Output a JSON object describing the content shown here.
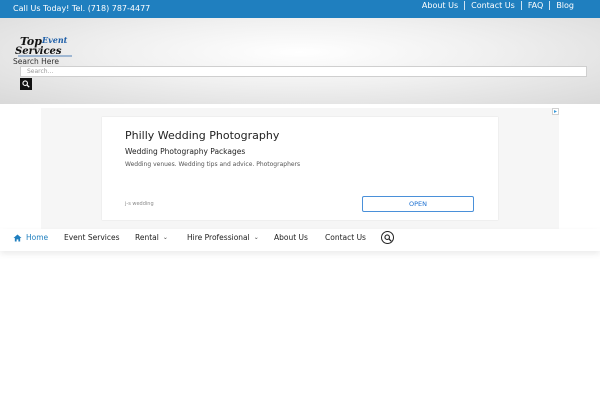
{
  "topbar": {
    "call_text": "Call Us Today! Tel. (718) 787-4477",
    "links": [
      "About Us",
      "Contact Us",
      "FAQ",
      "Blog"
    ]
  },
  "header": {
    "logo_top": "Top",
    "logo_event": "Event",
    "logo_services": "Services",
    "search_label": "Search Here",
    "search_placeholder": "Search..."
  },
  "ad": {
    "title": "Philly Wedding Photography",
    "subtitle": "Wedding Photography Packages",
    "description": "Wedding venues. Wedding tips and advice. Photographers",
    "source": "j-s wedding",
    "button_label": "OPEN"
  },
  "nav": {
    "items": [
      {
        "label": "Home",
        "icon": "home-icon"
      },
      {
        "label": "Event Services"
      },
      {
        "label": "Rental",
        "dropdown": true
      },
      {
        "label": "Hire Professional",
        "dropdown": true
      },
      {
        "label": "About Us"
      },
      {
        "label": "Contact Us"
      }
    ]
  },
  "colors": {
    "topbar": "#1f7fbf",
    "accent": "#1f7fbf",
    "ad_button_border": "#4a90d9"
  }
}
